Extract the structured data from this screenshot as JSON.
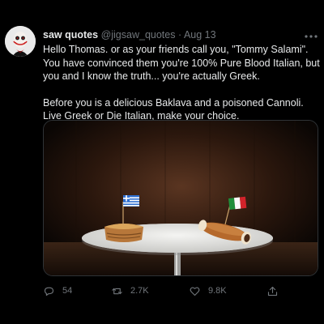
{
  "tweet": {
    "display_name": "saw quotes",
    "handle": "@jigsaw_quotes",
    "separator": "·",
    "date": "Aug 13",
    "text_paragraph_1": "Hello Thomas. or as your friends call you, \"Tommy Salami\". You have convinced them you're 100% Pure Blood Italian, but you and I know the truth... you're actually Greek.",
    "text_paragraph_2": "Before you is a delicious Baklava and a poisoned Cannoli. Live Greek or Die Italian, make your choice."
  },
  "actions": {
    "replies": "54",
    "retweets": "2.7K",
    "likes": "9.8K"
  },
  "icons": [
    "avatar-jigsaw-puppet",
    "more-icon",
    "reply-icon",
    "retweet-icon",
    "like-icon",
    "share-icon"
  ],
  "colors": {
    "background": "#000000",
    "text": "#e7e9ea",
    "muted": "#71767b"
  }
}
